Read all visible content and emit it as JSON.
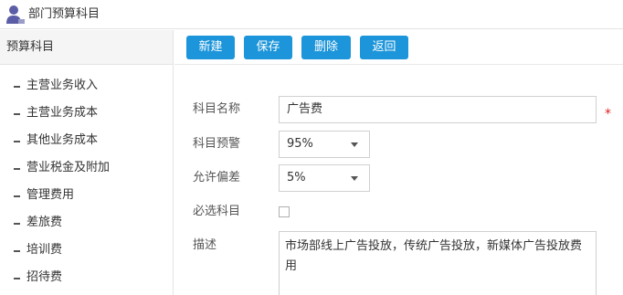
{
  "window": {
    "title": "部门预算科目",
    "icon": "user-icon"
  },
  "sidebar": {
    "title": "预算科目",
    "items": [
      {
        "label": "主营业务收入"
      },
      {
        "label": "主营业务成本"
      },
      {
        "label": "其他业务成本"
      },
      {
        "label": "营业税金及附加"
      },
      {
        "label": "管理费用"
      },
      {
        "label": "差旅费"
      },
      {
        "label": "培训费"
      },
      {
        "label": "招待费"
      }
    ]
  },
  "toolbar": {
    "new_label": "新建",
    "save_label": "保存",
    "delete_label": "删除",
    "back_label": "返回"
  },
  "form": {
    "name_label": "科目名称",
    "name_value": "广告费",
    "required_mark": "*",
    "warning_label": "科目预警",
    "warning_value": "95%",
    "deviation_label": "允许偏差",
    "deviation_value": "5%",
    "mandatory_label": "必选科目",
    "mandatory_checked": false,
    "description_label": "描述",
    "description_value": "市场部线上广告投放，传统广告投放，新媒体广告投放费用"
  },
  "colors": {
    "accent": "#1c95da",
    "required": "#e02020",
    "icon": "#5b5ea6"
  }
}
